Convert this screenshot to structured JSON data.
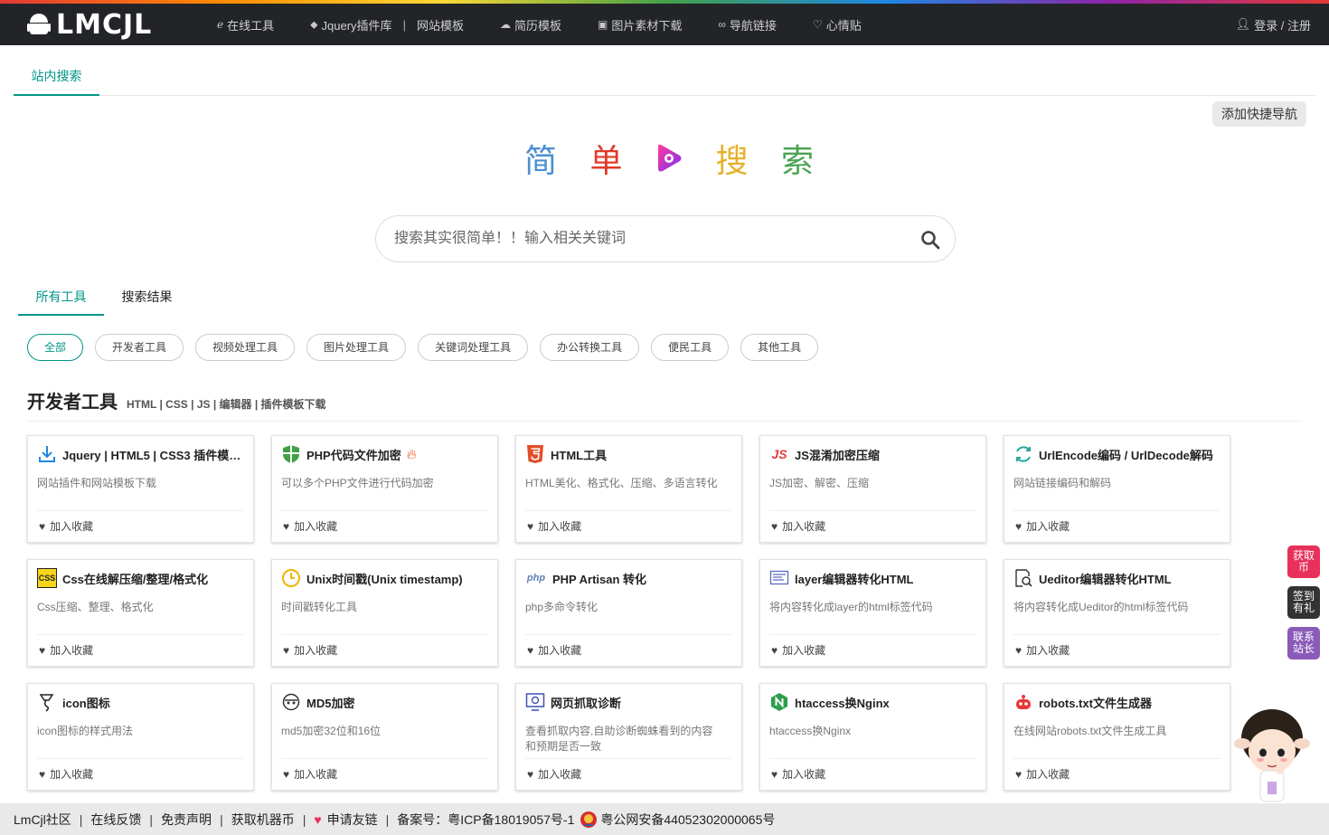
{
  "header": {
    "logo_text": "LMCJL",
    "nav": [
      {
        "icon": "ie-icon",
        "label": "在线工具"
      },
      {
        "icon": "tag-icon",
        "label": "Jquery插件库",
        "sep": "|",
        "label2": "网站模板"
      },
      {
        "icon": "cloud-icon",
        "label": "简历模板"
      },
      {
        "icon": "image-icon",
        "label": "图片素材下载"
      },
      {
        "icon": "link-icon",
        "label": "导航链接"
      },
      {
        "icon": "heart-icon",
        "label": "心情贴"
      }
    ],
    "login": "登录 / 注册"
  },
  "top_tab": "站内搜索",
  "quick_nav": "添加快捷导航",
  "slogan": {
    "chars": [
      "简",
      "单",
      "搜",
      "索"
    ],
    "colors": [
      "#4a8fd1",
      "#e03a2a",
      "#e6b12a",
      "#4aa352"
    ]
  },
  "search": {
    "placeholder": "搜索其实很简单！！输入相关关键词"
  },
  "result_tabs": [
    "所有工具",
    "搜索结果"
  ],
  "filters": [
    "全部",
    "开发者工具",
    "视频处理工具",
    "图片处理工具",
    "关键词处理工具",
    "办公转换工具",
    "便民工具",
    "其他工具"
  ],
  "section": {
    "title": "开发者工具",
    "subtitle": "HTML | CSS | JS | 编辑器 | 插件模板下载"
  },
  "fav_label": "加入收藏",
  "cards": [
    {
      "title": "Jquery | HTML5 | CSS3 插件模板下载",
      "desc": "网站插件和网站模板下载",
      "icon": "download-icon"
    },
    {
      "title": "PHP代码文件加密",
      "desc": "可以多个PHP文件进行代码加密",
      "icon": "shield-icon"
    },
    {
      "title": "HTML工具",
      "desc": "HTML美化、格式化、压缩、多语言转化",
      "icon": "html5-icon"
    },
    {
      "title": "JS混淆加密压缩",
      "desc": "JS加密、解密、压缩",
      "icon": "js-icon"
    },
    {
      "title": "UrlEncode编码 / UrlDecode解码",
      "desc": "网站链接编码和解码",
      "icon": "refresh-icon"
    },
    {
      "title": "Css在线解压缩/整理/格式化",
      "desc": "Css压缩、整理、格式化",
      "icon": "css-icon"
    },
    {
      "title": "Unix时间戳(Unix timestamp)",
      "desc": "时间戳转化工具",
      "icon": "clock-icon"
    },
    {
      "title": "PHP Artisan 转化",
      "desc": "php多命令转化",
      "icon": "php-icon"
    },
    {
      "title": "layer编辑器转化HTML",
      "desc": "将内容转化成layer的html标签代码",
      "icon": "editor-icon"
    },
    {
      "title": "Ueditor编辑器转化HTML",
      "desc": "将内容转化成Ueditor的html标签代码",
      "icon": "doc-search-icon"
    },
    {
      "title": "icon图标",
      "desc": "icon图标的样式用法",
      "icon": "brush-icon"
    },
    {
      "title": "MD5加密",
      "desc": "md5加密32位和16位",
      "icon": "mask-icon"
    },
    {
      "title": "网页抓取诊断",
      "desc": "查看抓取内容,自助诊断蜘蛛看到的内容和预期是否一致",
      "icon": "monitor-icon"
    },
    {
      "title": "htaccess换Nginx",
      "desc": "htaccess换Nginx",
      "icon": "nginx-icon"
    },
    {
      "title": "robots.txt文件生成器",
      "desc": "在线网站robots.txt文件生成工具",
      "icon": "robot-icon"
    }
  ],
  "side_buttons": [
    {
      "label": "获取\n币",
      "color": "#e8305a"
    },
    {
      "label": "签到\n有礼",
      "color": "#333333"
    },
    {
      "label": "联系\n站长",
      "color": "#8a5bb8"
    }
  ],
  "footer": {
    "items": [
      "LmCjl社区",
      "在线反馈",
      "免责声明",
      "获取机器币",
      "申请友链",
      "备案号：粤ICP备18019057号-1",
      "粤公网安备44052302000065号"
    ]
  },
  "accent": "#009688"
}
